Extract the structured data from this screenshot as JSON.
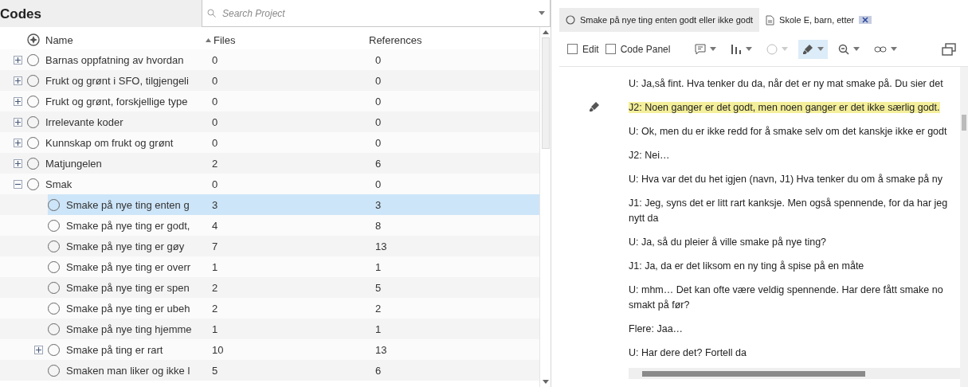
{
  "codes_panel": {
    "title": "Codes",
    "search": {
      "placeholder": "Search Project"
    },
    "columns": [
      {
        "label": "Name",
        "sorted": false
      },
      {
        "label": "Files",
        "sorted": true
      },
      {
        "label": "References",
        "sorted": false
      }
    ],
    "rows": [
      {
        "name": "Barnas oppfatning av hvordan",
        "files": "0",
        "references": "0",
        "expanded": false,
        "has_children": true,
        "selected": false
      },
      {
        "name": "Frukt og grønt i SFO, tilgjengeli",
        "files": "0",
        "references": "0",
        "expanded": false,
        "has_children": true,
        "selected": false
      },
      {
        "name": "Frukt og grønt, forskjellige type",
        "files": "0",
        "references": "0",
        "expanded": false,
        "has_children": true,
        "selected": false
      },
      {
        "name": "Irrelevante koder",
        "files": "0",
        "references": "0",
        "expanded": false,
        "has_children": true,
        "selected": false
      },
      {
        "name": "Kunnskap om frukt og grønt",
        "files": "0",
        "references": "0",
        "expanded": false,
        "has_children": true,
        "selected": false
      },
      {
        "name": "Matjungelen",
        "files": "2",
        "references": "6",
        "expanded": false,
        "has_children": true,
        "selected": false
      },
      {
        "name": "Smak",
        "files": "0",
        "references": "0",
        "expanded": true,
        "has_children": true,
        "selected": false,
        "children": [
          {
            "name": "Smake på nye ting enten g",
            "files": "3",
            "references": "3",
            "has_children": false,
            "selected": true
          },
          {
            "name": "Smake på nye ting er godt,",
            "files": "4",
            "references": "8",
            "has_children": false,
            "selected": false
          },
          {
            "name": "Smake på nye ting er gøy",
            "files": "7",
            "references": "13",
            "has_children": false,
            "selected": false
          },
          {
            "name": "Smake på nye ting er overr",
            "files": "1",
            "references": "1",
            "has_children": false,
            "selected": false
          },
          {
            "name": "Smake på nye ting er spen",
            "files": "2",
            "references": "5",
            "has_children": false,
            "selected": false
          },
          {
            "name": "Smake på nye ting er ubeh",
            "files": "2",
            "references": "2",
            "has_children": false,
            "selected": false
          },
          {
            "name": "Smake på nye ting hjemme",
            "files": "1",
            "references": "1",
            "has_children": false,
            "selected": false
          },
          {
            "name": "Smake på ting er rart",
            "files": "10",
            "references": "13",
            "has_children": true,
            "expanded": false,
            "selected": false
          },
          {
            "name": "Smaken man liker og ikke l",
            "files": "5",
            "references": "6",
            "has_children": false,
            "selected": false
          }
        ]
      }
    ]
  },
  "document_panel": {
    "tabs": [
      {
        "label": "Smake på nye ting enten godt eller ikke godt",
        "kind": "code",
        "selected": false
      },
      {
        "label": "Skole E, barn, etter",
        "kind": "document",
        "selected": true
      }
    ],
    "toolbar": {
      "checkboxes": [
        {
          "label": "Edit",
          "checked": false
        },
        {
          "label": "Code Panel",
          "checked": false
        }
      ],
      "tools": [
        {
          "kind": "memo",
          "disabled": false,
          "selected": false
        },
        {
          "kind": "bars",
          "disabled": false,
          "selected": false
        },
        {
          "kind": "circle",
          "disabled": true,
          "selected": false
        },
        {
          "kind": "highlighter",
          "disabled": false,
          "selected": true
        },
        {
          "kind": "zoom",
          "disabled": false,
          "selected": false
        },
        {
          "kind": "link",
          "disabled": false,
          "selected": false
        },
        {
          "kind": "window",
          "disabled": false,
          "selected": false
        }
      ]
    },
    "paragraphs": [
      {
        "lines": [
          "U: Ja,så fint. Hva tenker du da, når det er ny mat smake på. Du sier det"
        ],
        "highlighted": false
      },
      {
        "lines": [
          "J2: Noen ganger er det godt, men noen ganger er det ikke særlig godt."
        ],
        "highlighted": true
      },
      {
        "lines": [
          "U: Ok, men du er ikke redd for å smake selv om det kanskje ikke er godt"
        ],
        "highlighted": false
      },
      {
        "lines": [
          "J2: Nei…"
        ],
        "highlighted": false
      },
      {
        "lines": [
          "U: Hva var det du het igjen (navn, J1) Hva tenker du om å smake på ny"
        ],
        "highlighted": false
      },
      {
        "lines": [
          "J1: Jeg, syns det er litt rart kanksje. Men også spennende, for da har jeg",
          "nytt da"
        ],
        "highlighted": false
      },
      {
        "lines": [
          "U: Ja, så du pleier å ville smake på nye ting?"
        ],
        "highlighted": false
      },
      {
        "lines": [
          "J1: Ja, da er det liksom en ny ting å spise på en måte"
        ],
        "highlighted": false
      },
      {
        "lines": [
          "U: mhm…  Det kan ofte være veldig spennende. Har dere fått smake no",
          "smakt på før?"
        ],
        "highlighted": false
      },
      {
        "lines": [
          "Flere: Jaa…"
        ],
        "highlighted": false
      },
      {
        "lines": [
          "U: Har dere det? Fortell da"
        ],
        "highlighted": false
      }
    ]
  }
}
